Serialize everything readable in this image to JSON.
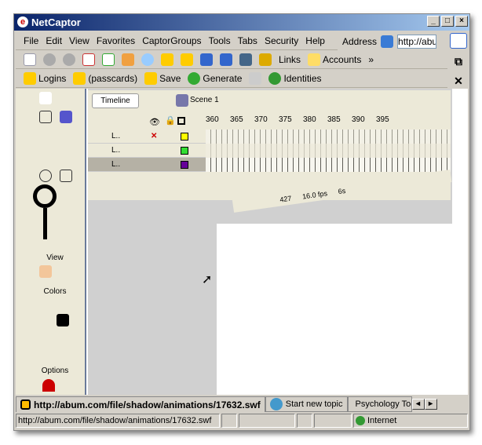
{
  "window": {
    "title": "NetCaptor",
    "controls": [
      "_",
      "□",
      "×"
    ]
  },
  "menu": [
    "File",
    "Edit",
    "View",
    "Favorites",
    "CaptorGroups",
    "Tools",
    "Tabs",
    "Security",
    "Help"
  ],
  "address": {
    "label": "Address",
    "value": "http://abu"
  },
  "toolbar": {
    "links_label": "Links",
    "accounts_label": "Accounts",
    "more": "»"
  },
  "logins_bar": {
    "logins": "Logins",
    "passcards": "(passcards)",
    "save": "Save",
    "generate": "Generate",
    "identities": "Identities"
  },
  "flash": {
    "timeline_button": "Timeline",
    "scene": "Scene 1",
    "ruler": [
      "360",
      "365",
      "370",
      "375",
      "380",
      "385",
      "390",
      "395"
    ],
    "layers": [
      {
        "name": "L..",
        "color": "#ffff00"
      },
      {
        "name": "L..",
        "color": "#33dd33"
      },
      {
        "name": "L..",
        "color": "#660099"
      }
    ],
    "frame": "427",
    "fps": "16.0 fps",
    "time": "6s",
    "panels": {
      "view": "View",
      "colors": "Colors",
      "options": "Options"
    }
  },
  "tabs": [
    {
      "label": "http://abum.com/file/shadow/animations/17632.swf",
      "active": true
    },
    {
      "label": "Start new topic"
    },
    {
      "label": "Psychology Tod"
    }
  ],
  "status": {
    "url": "http://abum.com/file/shadow/animations/17632.swf",
    "zone": "Internet"
  }
}
